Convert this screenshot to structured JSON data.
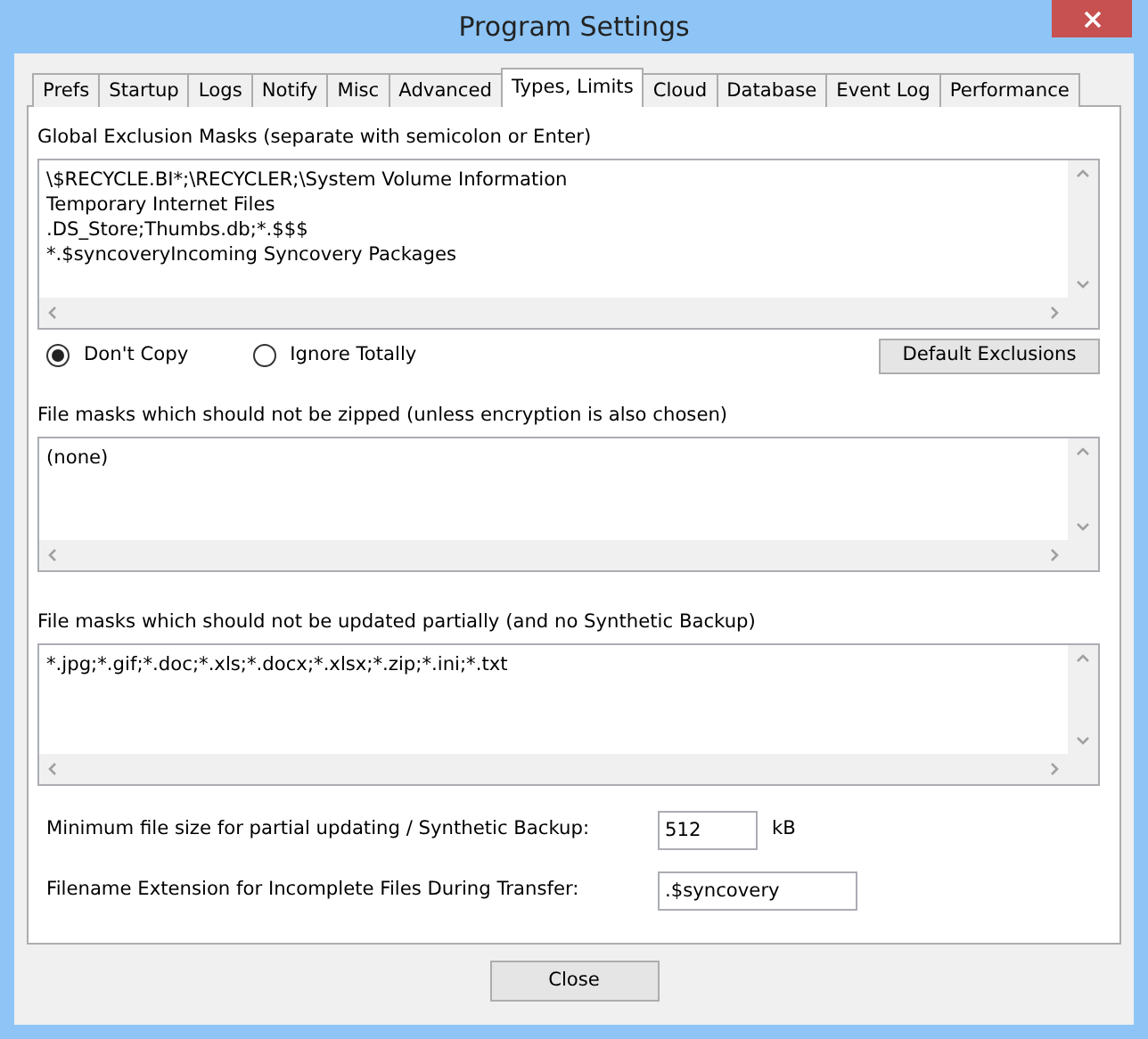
{
  "window": {
    "title": "Program Settings"
  },
  "tabs": [
    {
      "label": "Prefs",
      "selected": false
    },
    {
      "label": "Startup",
      "selected": false
    },
    {
      "label": "Logs",
      "selected": false
    },
    {
      "label": "Notify",
      "selected": false
    },
    {
      "label": "Misc",
      "selected": false
    },
    {
      "label": "Advanced",
      "selected": false
    },
    {
      "label": "Types, Limits",
      "selected": true
    },
    {
      "label": "Cloud",
      "selected": false
    },
    {
      "label": "Database",
      "selected": false
    },
    {
      "label": "Event Log",
      "selected": false
    },
    {
      "label": "Performance",
      "selected": false
    }
  ],
  "exclusion_masks": {
    "label": "Global Exclusion Masks (separate with semicolon or Enter)",
    "lines": [
      "\\$RECYCLE.BI*;\\RECYCLER;\\System Volume Information",
      "Temporary Internet Files",
      ".DS_Store;Thumbs.db;*.$$$",
      "*.$syncoveryIncoming Syncovery Packages"
    ]
  },
  "exclusion_mode": [
    {
      "label": "Don't Copy",
      "selected": true
    },
    {
      "label": "Ignore Totally",
      "selected": false
    }
  ],
  "default_exclusions_button": "Default Exclusions",
  "no_zip_masks": {
    "label": "File masks which should not be zipped (unless encryption is also chosen)",
    "lines": [
      "(none)"
    ]
  },
  "no_partial_masks": {
    "label": "File masks which should not be updated partially (and no Synthetic Backup)",
    "lines": [
      "*.jpg;*.gif;*.doc;*.xls;*.docx;*.xlsx;*.zip;*.ini;*.txt"
    ]
  },
  "min_file_size": {
    "label": "Minimum file size for partial updating / Synthetic Backup:",
    "value": "512",
    "unit": "kB"
  },
  "incomplete_extension": {
    "label": "Filename Extension for Incomplete Files During Transfer:",
    "value": ".$syncovery"
  },
  "close_button": "Close"
}
